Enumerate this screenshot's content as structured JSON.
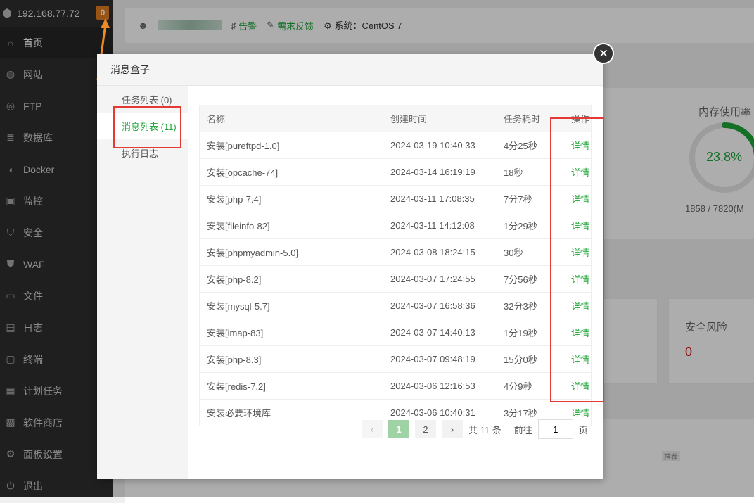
{
  "sidebar": {
    "ip": "192.168.77.72",
    "badge": "0",
    "items": [
      {
        "label": "首页",
        "icon": "home-icon"
      },
      {
        "label": "网站",
        "icon": "globe-icon"
      },
      {
        "label": "FTP",
        "icon": "ftp-icon"
      },
      {
        "label": "数据库",
        "icon": "database-icon"
      },
      {
        "label": "Docker",
        "icon": "docker-icon"
      },
      {
        "label": "监控",
        "icon": "monitor-icon"
      },
      {
        "label": "安全",
        "icon": "shield-icon"
      },
      {
        "label": "WAF",
        "icon": "waf-icon"
      },
      {
        "label": "文件",
        "icon": "folder-icon"
      },
      {
        "label": "日志",
        "icon": "log-icon"
      },
      {
        "label": "终端",
        "icon": "terminal-icon"
      },
      {
        "label": "计划任务",
        "icon": "calendar-icon"
      },
      {
        "label": "软件商店",
        "icon": "store-icon"
      },
      {
        "label": "面板设置",
        "icon": "gear-icon"
      },
      {
        "label": "退出",
        "icon": "logout-icon"
      }
    ]
  },
  "topbar": {
    "alarm": "告警",
    "feedback": "需求反馈",
    "system": "系统：CentOS 7"
  },
  "background": {
    "mem_title": "内存使用率",
    "mem_value": "23.8%",
    "mem_usage": 0.238,
    "mem_sub": "1858 / 7820(M",
    "risk_title": "安全风险",
    "risk_value": "0",
    "recommend": "推荐"
  },
  "modal": {
    "title": "消息盒子",
    "tabs": [
      {
        "label": "任务列表 (0)"
      },
      {
        "label": "消息列表 (11)"
      },
      {
        "label": "执行日志"
      }
    ],
    "table": {
      "headers": [
        "名称",
        "创建时间",
        "任务耗时",
        "操作"
      ],
      "rows": [
        {
          "name": "安装[pureftpd-1.0]",
          "time": "2024-03-19 10:40:33",
          "duration": "4分25秒",
          "action": "详情"
        },
        {
          "name": "安装[opcache-74]",
          "time": "2024-03-14 16:19:19",
          "duration": "18秒",
          "action": "详情"
        },
        {
          "name": "安装[php-7.4]",
          "time": "2024-03-11 17:08:35",
          "duration": "7分7秒",
          "action": "详情"
        },
        {
          "name": "安装[fileinfo-82]",
          "time": "2024-03-11 14:12:08",
          "duration": "1分29秒",
          "action": "详情"
        },
        {
          "name": "安装[phpmyadmin-5.0]",
          "time": "2024-03-08 18:24:15",
          "duration": "30秒",
          "action": "详情"
        },
        {
          "name": "安装[php-8.2]",
          "time": "2024-03-07 17:24:55",
          "duration": "7分56秒",
          "action": "详情"
        },
        {
          "name": "安装[mysql-5.7]",
          "time": "2024-03-07 16:58:36",
          "duration": "32分3秒",
          "action": "详情"
        },
        {
          "name": "安装[imap-83]",
          "time": "2024-03-07 14:40:13",
          "duration": "1分19秒",
          "action": "详情"
        },
        {
          "name": "安装[php-8.3]",
          "time": "2024-03-07 09:48:19",
          "duration": "15分0秒",
          "action": "详情"
        },
        {
          "name": "安装[redis-7.2]",
          "time": "2024-03-06 12:16:53",
          "duration": "4分9秒",
          "action": "详情"
        },
        {
          "name": "安装必要环境库",
          "time": "2024-03-06 10:40:31",
          "duration": "3分17秒",
          "action": "详情"
        }
      ]
    },
    "pager": {
      "prev": "‹",
      "page1": "1",
      "page2": "2",
      "next": "›",
      "total": "共 11 条",
      "goto_prefix": "前往",
      "goto_value": "1",
      "goto_suffix": "页"
    }
  },
  "colors": {
    "accent": "#20a53a",
    "highlight": "#e53935",
    "arrow": "#f08a24"
  }
}
